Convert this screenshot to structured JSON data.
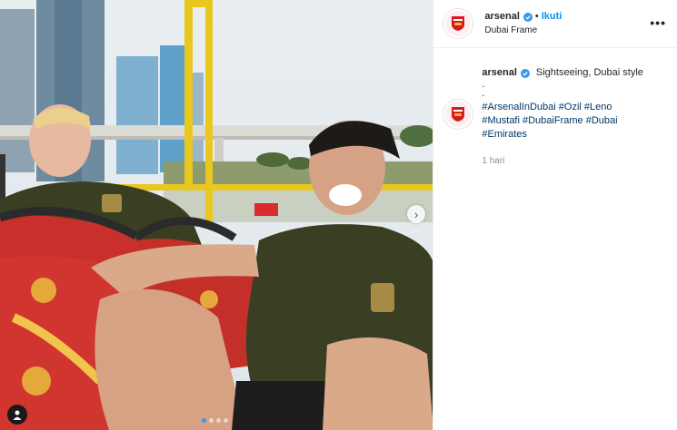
{
  "post": {
    "username": "arsenal",
    "follow_label": "Ikuti",
    "separator": "•",
    "location": "Dubai Frame",
    "more_label": "•••",
    "caption_text": "Sightseeing, Dubai style",
    "caption_dots": [
      ".",
      "."
    ],
    "hashtags": [
      "#ArsenalInDubai",
      "#Ozil",
      "#Leno",
      "#Mustafi",
      "#DubaiFrame",
      "#Dubai",
      "#Emirates"
    ],
    "time_ago": "1 hari",
    "carousel": {
      "count": 4,
      "active_index": 0
    },
    "next_icon": "chevron-right-icon",
    "tag_icon": "user-tag-icon"
  },
  "colors": {
    "link_blue": "#0095f6",
    "hashtag": "#00376b",
    "verified": "#3897f0",
    "jersey": "#3a3f24",
    "seat_red": "#c9302c",
    "bus_rail": "#e8c81f"
  }
}
